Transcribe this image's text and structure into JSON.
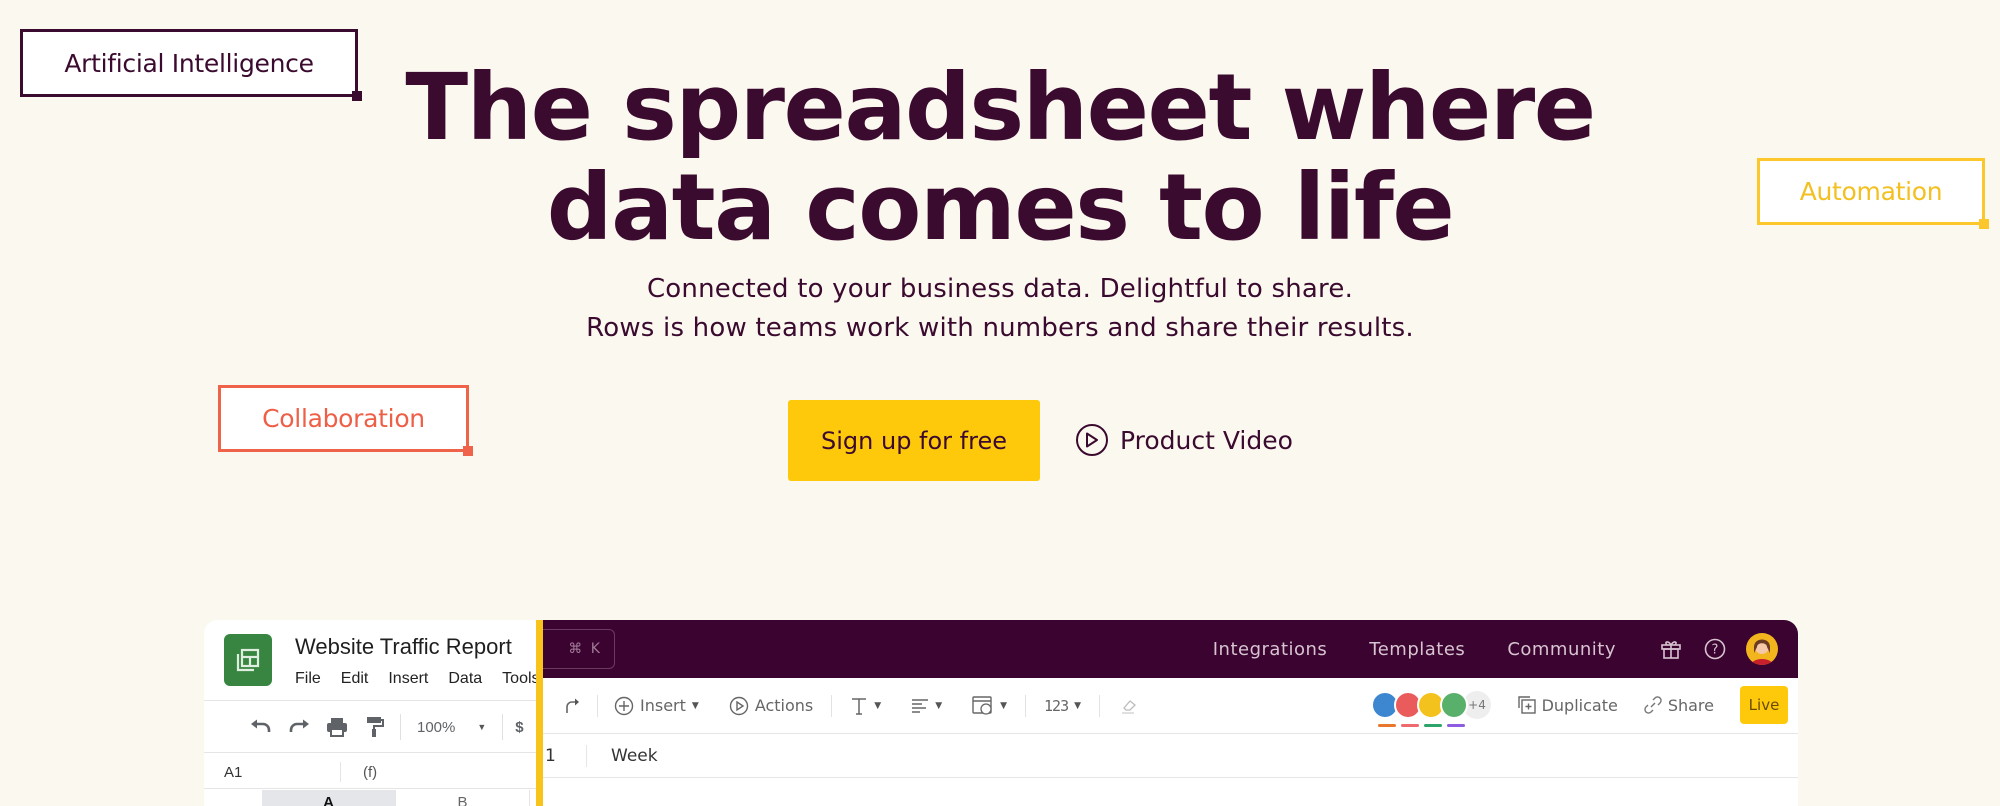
{
  "tags": {
    "ai": "Artificial Intelligence",
    "automation": "Automation",
    "collaboration": "Collaboration"
  },
  "hero": {
    "title_line1": "The spreadsheet where",
    "title_line2": "data comes to life",
    "subtitle_line1": "Connected to your business data. Delightful to share.",
    "subtitle_line2": "Rows is how teams work with numbers and share their results.",
    "primary_cta": "Sign up for free",
    "secondary_cta": "Product Video"
  },
  "colors": {
    "brand_dark": "#3b0a2f",
    "brand_yellow": "#fec90a",
    "accent_coral": "#f0634b",
    "background": "#fbf9ef"
  },
  "sheets_panel": {
    "title": "Website Traffic Report",
    "menu": [
      "File",
      "Edit",
      "Insert",
      "Data",
      "Tools"
    ],
    "toolbar": {
      "icons": [
        "undo-icon",
        "redo-icon",
        "print-icon",
        "paint-format-icon"
      ],
      "zoom": "100%",
      "currency": "$"
    },
    "cell_ref": "A1",
    "fx": "(f)",
    "columns": [
      "A",
      "B"
    ]
  },
  "rows_app": {
    "search_shortcut": "⌘ K",
    "nav": [
      "Integrations",
      "Templates",
      "Community"
    ],
    "toolbar": {
      "insert": "Insert",
      "actions": "Actions",
      "number_format": "123",
      "collaborators_more": "+4",
      "duplicate": "Duplicate",
      "share": "Share",
      "live": "Live"
    },
    "collaborator_colors": [
      "#e8792c",
      "#ee6a6e",
      "#2ea36a",
      "#8e5ce0"
    ],
    "grid": {
      "row_number": "1",
      "cell_value": "Week"
    }
  }
}
